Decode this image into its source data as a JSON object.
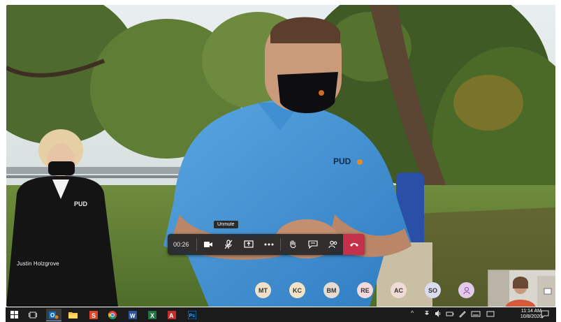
{
  "call": {
    "timer": "00:26",
    "tooltip": "Unmute",
    "speaker_name": "Justin Holzgrove",
    "shirt_logo": "PUD"
  },
  "toolbar": {
    "buttons": [
      "camera-icon",
      "mic-muted-icon",
      "share-screen-icon",
      "more-options-icon",
      "raise-hand-icon",
      "chat-icon",
      "participants-icon",
      "hang-up-icon"
    ]
  },
  "participants": [
    {
      "initials": "MT",
      "color": "#f0e0c8"
    },
    {
      "initials": "KC",
      "color": "#f2e3c6"
    },
    {
      "initials": "BM",
      "color": "#e6dccf"
    },
    {
      "initials": "RE",
      "color": "#f3d9dc"
    },
    {
      "initials": "AC",
      "color": "#f0dcd6"
    },
    {
      "initials": "SO",
      "color": "#d9dcef"
    },
    {
      "initials": "",
      "color": "#e3c9ea"
    }
  ],
  "taskbar": {
    "apps": [
      "windows-start-icon",
      "task-view-icon",
      "outlook-icon",
      "file-explorer-icon",
      "slides-app-icon",
      "chrome-icon",
      "word-icon",
      "excel-icon",
      "acrobat-icon",
      "photoshop-icon"
    ],
    "time": "11:14 AM",
    "date": "10/8/2020",
    "accent": "#c4314b"
  }
}
